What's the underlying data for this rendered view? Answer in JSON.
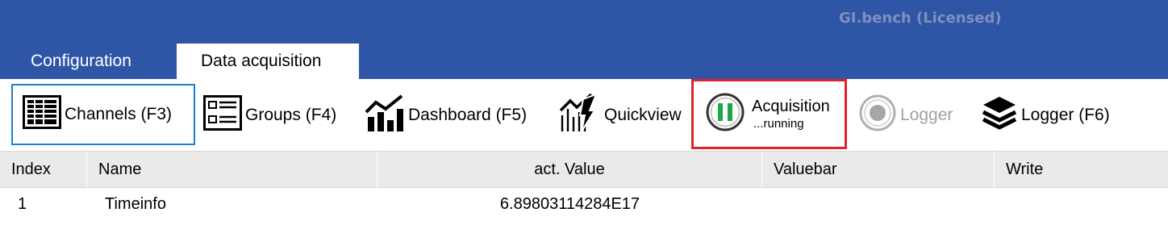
{
  "app": {
    "title": "GI.bench (Licensed)"
  },
  "tabs": [
    {
      "label": "Configuration",
      "active": false
    },
    {
      "label": "Data acquisition",
      "active": true
    }
  ],
  "toolbar": {
    "channels": {
      "label": "Channels (F3)",
      "icon": "channels-table-icon",
      "selected": true
    },
    "groups": {
      "label": "Groups (F4)",
      "icon": "groups-icon"
    },
    "dashboard": {
      "label": "Dashboard (F5)",
      "icon": "dashboard-chart-icon"
    },
    "quickview": {
      "label": "Quickview",
      "icon": "quickview-icon"
    },
    "acquisition": {
      "label": "Acquisition",
      "status": "...running",
      "icon": "pause-icon",
      "icon_color": "#1aa84a",
      "highlight_color": "#e0202a"
    },
    "logger_disabled": {
      "label": "Logger",
      "icon": "record-icon",
      "enabled": false
    },
    "logger": {
      "label": "Logger (F6)",
      "icon": "layers-icon"
    }
  },
  "table": {
    "columns": [
      "Index",
      "Name",
      "act. Value",
      "Valuebar",
      "Write"
    ],
    "rows": [
      {
        "index": "1",
        "name": "Timeinfo",
        "value": "6.89803114284E17",
        "valuebar": "",
        "write": ""
      }
    ]
  },
  "colors": {
    "header_blue": "#2f56a6",
    "selection_blue": "#1a7fd0"
  }
}
